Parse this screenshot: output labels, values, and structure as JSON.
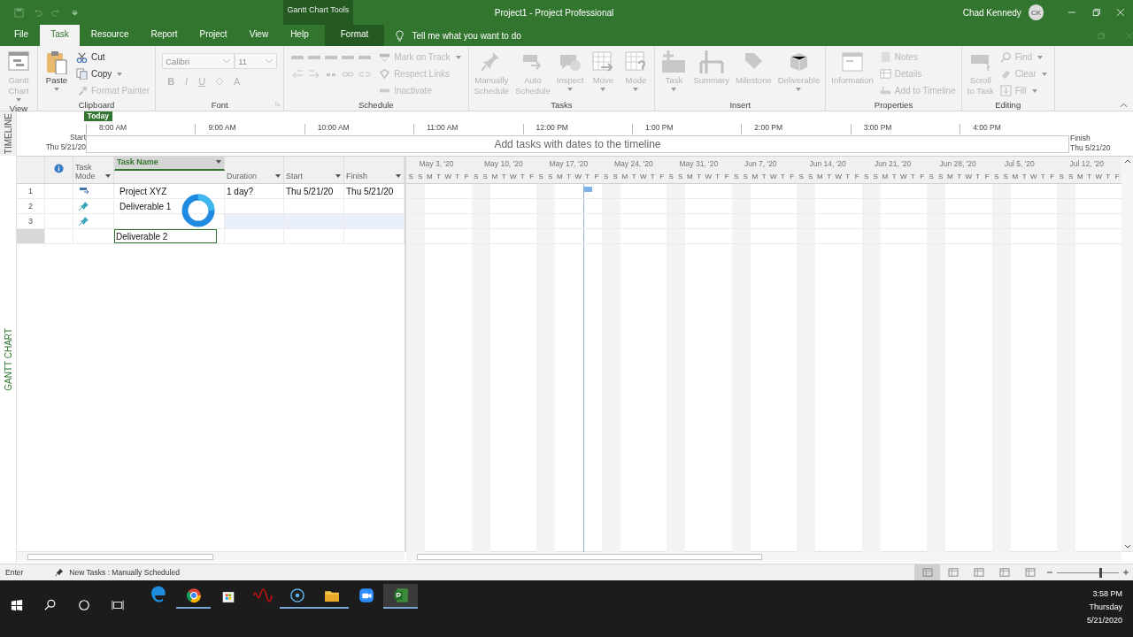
{
  "title_bar": {
    "context_label": "Gantt Chart Tools",
    "title": "Project1  -  Project Professional",
    "user": "Chad Kennedy",
    "avatar": "CK"
  },
  "tabs": [
    {
      "label": "File",
      "selected": false,
      "kind": "normal"
    },
    {
      "label": "Task",
      "selected": true,
      "kind": "normal"
    },
    {
      "label": "Resource",
      "selected": false,
      "kind": "normal"
    },
    {
      "label": "Report",
      "selected": false,
      "kind": "normal"
    },
    {
      "label": "Project",
      "selected": false,
      "kind": "normal"
    },
    {
      "label": "View",
      "selected": false,
      "kind": "normal"
    },
    {
      "label": "Help",
      "selected": false,
      "kind": "normal"
    },
    {
      "label": "Format",
      "selected": false,
      "kind": "context"
    }
  ],
  "tell_me": {
    "placeholder": "Tell me what you want to do"
  },
  "ribbon": {
    "groups": [
      {
        "label": "View",
        "items": [
          {
            "kind": "large",
            "lines": [
              "Gantt",
              "Chart"
            ],
            "dropdown": true,
            "disabled": true
          }
        ]
      },
      {
        "label": "Clipboard",
        "items": [
          {
            "kind": "large",
            "lines": [
              "Paste"
            ],
            "dropdown": true,
            "disabled": false
          },
          {
            "kind": "small",
            "lines": [
              "Cut"
            ],
            "dropdown": false,
            "disabled": false
          },
          {
            "kind": "small",
            "lines": [
              "Copy"
            ],
            "dropdown": true,
            "disabled": false
          },
          {
            "kind": "small",
            "lines": [
              "Format Painter"
            ],
            "dropdown": false,
            "disabled": true
          }
        ]
      },
      {
        "label": "Font",
        "launcher": true,
        "items": [
          {
            "kind": "font",
            "font": "Calibri",
            "size": "11",
            "buttons": [
              "B",
              "I",
              "U",
              "A"
            ]
          }
        ]
      },
      {
        "label": "Schedule",
        "items": [
          {
            "kind": "tools"
          },
          {
            "kind": "small",
            "lines": [
              "Mark on Track"
            ],
            "dropdown": true,
            "disabled": true
          },
          {
            "kind": "small",
            "lines": [
              "Respect Links"
            ],
            "dropdown": false,
            "disabled": true
          },
          {
            "kind": "small",
            "lines": [
              "Inactivate"
            ],
            "dropdown": false,
            "disabled": true
          }
        ]
      },
      {
        "label": "Tasks",
        "items": [
          {
            "kind": "large",
            "lines": [
              "Manually",
              "Schedule"
            ],
            "dropdown": false,
            "disabled": true
          },
          {
            "kind": "large",
            "lines": [
              "Auto",
              "Schedule"
            ],
            "dropdown": false,
            "disabled": true
          },
          {
            "kind": "large",
            "lines": [
              "Inspect"
            ],
            "dropdown": true,
            "disabled": true
          },
          {
            "kind": "large",
            "lines": [
              "Move"
            ],
            "dropdown": true,
            "disabled": true
          },
          {
            "kind": "large",
            "lines": [
              "Mode"
            ],
            "dropdown": true,
            "disabled": true
          }
        ]
      },
      {
        "label": "Insert",
        "items": [
          {
            "kind": "large",
            "lines": [
              "Task"
            ],
            "dropdown": true,
            "disabled": true
          },
          {
            "kind": "large",
            "lines": [
              "Summary"
            ],
            "dropdown": false,
            "disabled": true
          },
          {
            "kind": "large",
            "lines": [
              "Milestone"
            ],
            "dropdown": false,
            "disabled": true
          },
          {
            "kind": "large",
            "lines": [
              "Deliverable"
            ],
            "dropdown": true,
            "disabled": true
          }
        ]
      },
      {
        "label": "Properties",
        "items": [
          {
            "kind": "large",
            "lines": [
              "Information"
            ],
            "dropdown": false,
            "disabled": true
          },
          {
            "kind": "small",
            "lines": [
              "Notes"
            ],
            "dropdown": false,
            "disabled": true
          },
          {
            "kind": "small",
            "lines": [
              "Details"
            ],
            "dropdown": false,
            "disabled": true
          },
          {
            "kind": "small",
            "lines": [
              "Add to Timeline"
            ],
            "dropdown": false,
            "disabled": true
          }
        ]
      },
      {
        "label": "Editing",
        "items": [
          {
            "kind": "large",
            "lines": [
              "Scroll",
              "to Task"
            ],
            "dropdown": false,
            "disabled": true
          },
          {
            "kind": "small",
            "lines": [
              "Find"
            ],
            "dropdown": true,
            "disabled": true
          },
          {
            "kind": "small",
            "lines": [
              "Clear"
            ],
            "dropdown": true,
            "disabled": true
          },
          {
            "kind": "small",
            "lines": [
              "Fill"
            ],
            "dropdown": true,
            "disabled": true
          }
        ]
      }
    ]
  },
  "side_labels": {
    "timeline": "TIMELINE",
    "gantt": "GANTT CHART"
  },
  "timeline": {
    "today": "Today",
    "start_label": "Start",
    "start_date": "Thu 5/21/20",
    "finish_label": "Finish",
    "finish_date": "Thu 5/21/20",
    "hint": "Add tasks with dates to the timeline",
    "ticks": [
      "8:00 AM",
      "9:00 AM",
      "10:00 AM",
      "11:00 AM",
      "12:00 PM",
      "1:00 PM",
      "2:00 PM",
      "3:00 PM",
      "4:00 PM"
    ]
  },
  "table": {
    "columns": [
      {
        "label": "Task Mode",
        "selected": false
      },
      {
        "label": "Task Name",
        "selected": true
      },
      {
        "label": "Duration",
        "selected": false
      },
      {
        "label": "Start",
        "selected": false
      },
      {
        "label": "Finish",
        "selected": false
      }
    ],
    "rows": [
      {
        "id": "1",
        "kind": "summary",
        "name": "Project XYZ",
        "duration": "1 day?",
        "start": "Thu 5/21/20",
        "finish": "Thu 5/21/20",
        "selected": false,
        "editing": false
      },
      {
        "id": "2",
        "kind": "manual",
        "name": "Deliverable 1",
        "selected": false,
        "editing": false
      },
      {
        "id": "3",
        "kind": "manual",
        "selected": true,
        "editing": false
      },
      {
        "name": "Deliverable 2",
        "selected": false,
        "editing": true
      }
    ]
  },
  "gantt": {
    "lead_day": "S",
    "weeks": [
      {
        "label": "May 3, '20",
        "days": [
          "S",
          "M",
          "T",
          "W",
          "T",
          "F",
          "S"
        ]
      },
      {
        "label": "May 10, '20",
        "days": [
          "S",
          "M",
          "T",
          "W",
          "T",
          "F",
          "S"
        ]
      },
      {
        "label": "May 17, '20",
        "days": [
          "S",
          "M",
          "T",
          "W",
          "T",
          "F",
          "S"
        ]
      },
      {
        "label": "May 24, '20",
        "days": [
          "S",
          "M",
          "T",
          "W",
          "T",
          "F",
          "S"
        ]
      },
      {
        "label": "May 31, '20",
        "days": [
          "S",
          "M",
          "T",
          "W",
          "T",
          "F",
          "S"
        ]
      },
      {
        "label": "Jun 7, '20",
        "days": [
          "S",
          "M",
          "T",
          "W",
          "T",
          "F",
          "S"
        ]
      },
      {
        "label": "Jun 14, '20",
        "days": [
          "S",
          "M",
          "T",
          "W",
          "T",
          "F",
          "S"
        ]
      },
      {
        "label": "Jun 21, '20",
        "days": [
          "S",
          "M",
          "T",
          "W",
          "T",
          "F",
          "S"
        ]
      },
      {
        "label": "Jun 28, '20",
        "days": [
          "S",
          "M",
          "T",
          "W",
          "T",
          "F",
          "S"
        ]
      },
      {
        "label": "Jul 5, '20",
        "days": [
          "S",
          "M",
          "T",
          "W",
          "T",
          "F",
          "S"
        ]
      },
      {
        "label": "Jul 12, '20",
        "days": [
          "S",
          "M",
          "T",
          "W",
          "T",
          "F"
        ]
      }
    ]
  },
  "status_bar": {
    "mode": "Enter",
    "new_tasks": "New Tasks : Manually Scheduled",
    "views": [
      {
        "selected": true
      },
      {
        "selected": false
      },
      {
        "selected": false
      },
      {
        "selected": false
      },
      {
        "selected": false
      }
    ],
    "zoom": {
      "level": 0.7
    }
  },
  "taskbar": {
    "apps": [
      {
        "running": false,
        "active": false
      },
      {
        "running": true,
        "active": false
      },
      {
        "running": false,
        "active": false
      },
      {
        "running": false,
        "active": false
      },
      {
        "running": true,
        "active": false
      },
      {
        "running": true,
        "active": false
      },
      {
        "running": false,
        "active": false
      },
      {
        "running": true,
        "active": true
      }
    ],
    "time": "3:58 PM",
    "day": "Thursday",
    "date": "5/21/2020"
  }
}
